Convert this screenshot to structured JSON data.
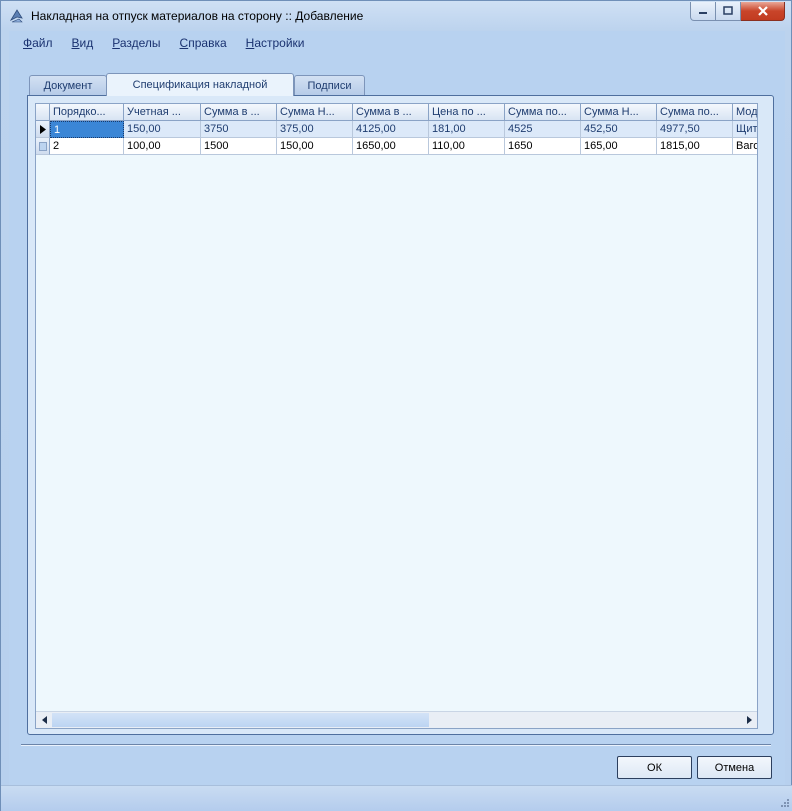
{
  "window": {
    "title": "Накладная на отпуск материалов на сторону :: Добавление"
  },
  "menu": [
    {
      "mnemonic": "Ф",
      "rest": "айл"
    },
    {
      "mnemonic": "В",
      "rest": "ид"
    },
    {
      "mnemonic": "Р",
      "rest": "азделы"
    },
    {
      "mnemonic": "С",
      "rest": "правка"
    },
    {
      "mnemonic": "Н",
      "rest": "астройки"
    }
  ],
  "tabs": [
    {
      "label": "Документ",
      "active": false
    },
    {
      "label": "Спецификация накладной",
      "active": true
    },
    {
      "label": "Подписи",
      "active": false
    }
  ],
  "grid": {
    "columns": [
      "Порядко...",
      "Учетная ...",
      "Сумма в ...",
      "Сумма Н...",
      "Сумма в ...",
      "Цена по ...",
      "Сумма по...",
      "Сумма Н...",
      "Сумма по...",
      "Мод"
    ],
    "rows": [
      {
        "current": true,
        "cells": [
          "1",
          "150,00",
          "3750",
          "375,00",
          "4125,00",
          "181,00",
          "4525",
          "452,50",
          "4977,50",
          "Щит"
        ]
      },
      {
        "current": false,
        "cells": [
          "2",
          "100,00",
          "1500",
          "150,00",
          "1650,00",
          "110,00",
          "1650",
          "165,00",
          "1815,00",
          "Ваго"
        ]
      }
    ]
  },
  "buttons": {
    "ok": "ОК",
    "cancel": "Отмена"
  },
  "colors": {
    "window_bg": "#b8d2f0",
    "grid_bg": "#eef8fd",
    "selected_cell": "#3b86d6",
    "close_button": "#c9452a"
  }
}
